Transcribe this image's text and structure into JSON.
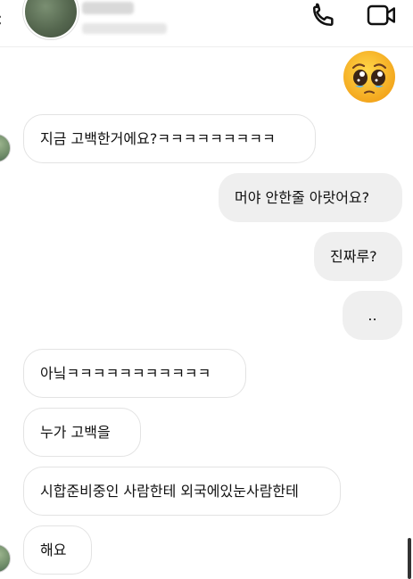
{
  "header": {
    "back_icon": "chevron-left-icon",
    "call_icon": "phone-icon",
    "video_icon": "video-camera-icon"
  },
  "sticker": {
    "icon": "pleading-face-emoji-icon"
  },
  "messages": [
    {
      "dir": "in",
      "text": "지금 고백한거에요?ㅋㅋㅋㅋㅋㅋㅋㅋㅋ"
    },
    {
      "dir": "out",
      "text": "머야 안한줄 아랏어요?"
    },
    {
      "dir": "out",
      "text": "진짜루?"
    },
    {
      "dir": "out",
      "text": ".."
    },
    {
      "dir": "in",
      "text": "아닠ㅋㅋㅋㅋㅋㅋㅋㅋㅋㅋㅋ"
    },
    {
      "dir": "in",
      "text": "누가 고백을"
    },
    {
      "dir": "in",
      "text": "시합준비중인 사람한테 외국에있눈사람한테"
    },
    {
      "dir": "in",
      "text": "해요"
    }
  ]
}
